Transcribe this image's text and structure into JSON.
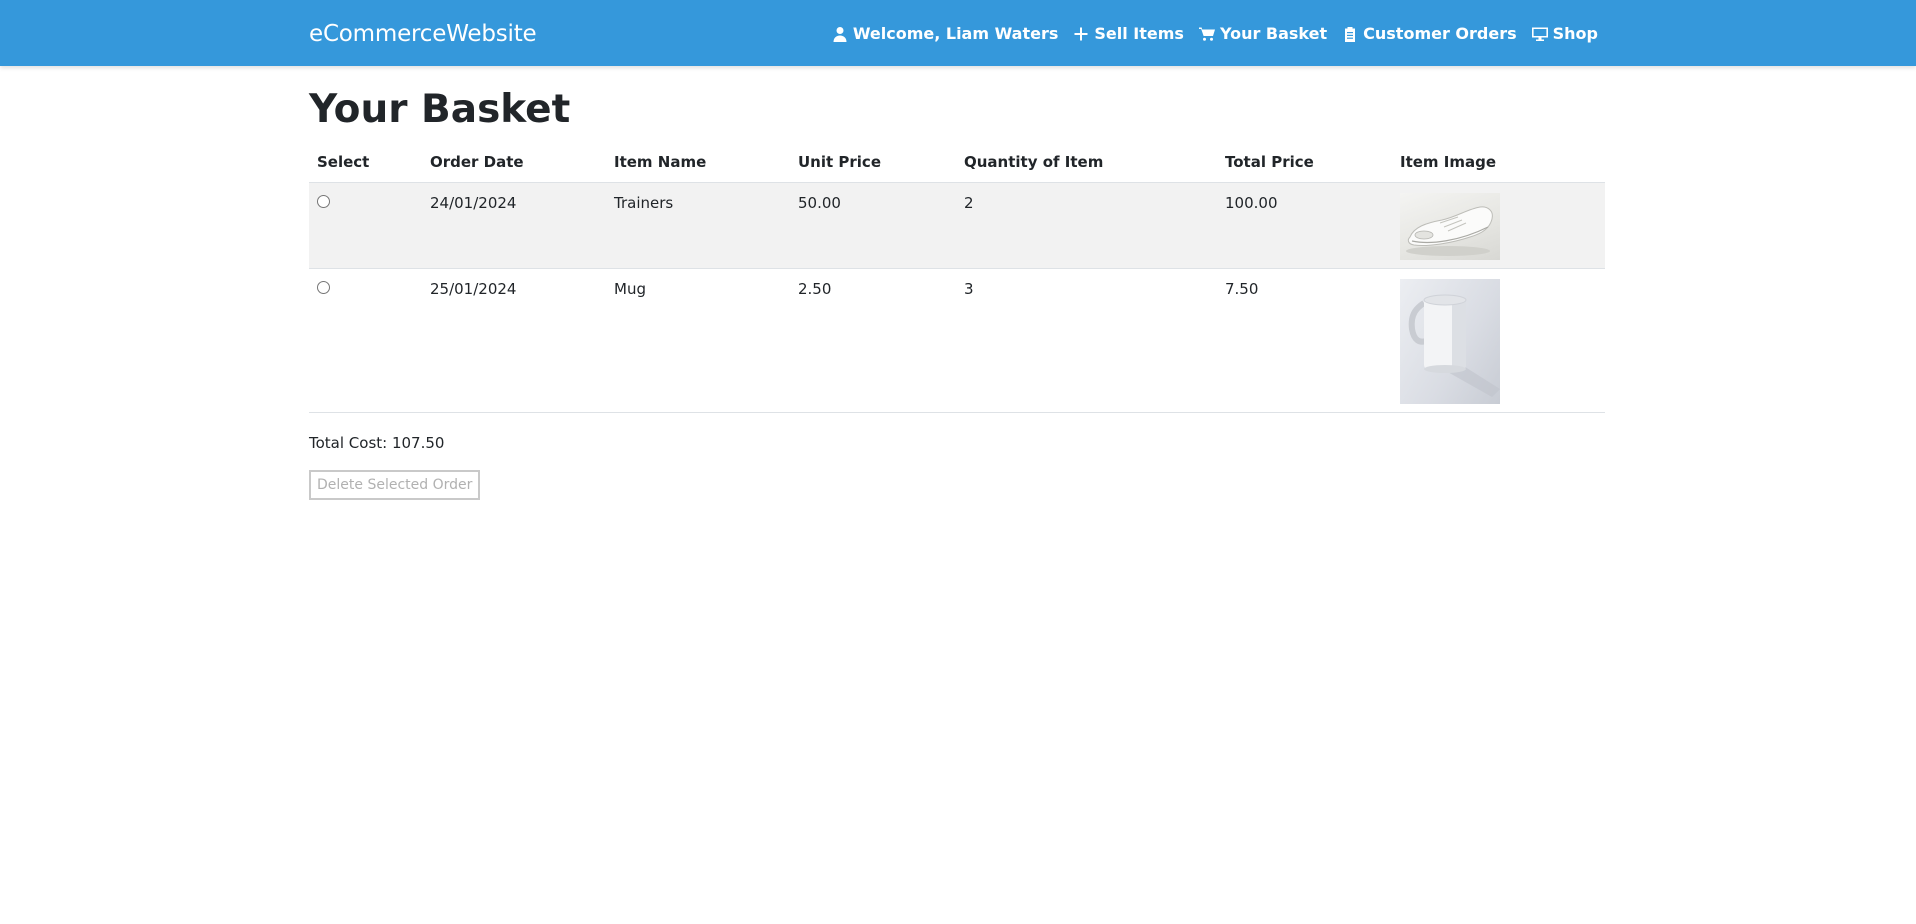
{
  "navbar": {
    "brand": "eCommerceWebsite",
    "background_color": "#3598db",
    "links": [
      {
        "label": "Welcome, Liam Waters",
        "icon": "user-icon"
      },
      {
        "label": "Sell Items",
        "icon": "plus-icon"
      },
      {
        "label": "Your Basket",
        "icon": "cart-icon"
      },
      {
        "label": "Customer Orders",
        "icon": "clipboard-icon"
      },
      {
        "label": "Shop",
        "icon": "monitor-icon"
      }
    ]
  },
  "page": {
    "title": "Your Basket"
  },
  "table": {
    "headers": [
      "Select",
      "Order Date",
      "Item Name",
      "Unit Price",
      "Quantity of Item",
      "Total Price",
      "Item Image"
    ],
    "rows": [
      {
        "order_date": "24/01/2024",
        "item_name": "Trainers",
        "unit_price": "50.00",
        "quantity": "2",
        "total_price": "100.00",
        "image": "trainers-photo",
        "selected": false
      },
      {
        "order_date": "25/01/2024",
        "item_name": "Mug",
        "unit_price": "2.50",
        "quantity": "3",
        "total_price": "7.50",
        "image": "mug-photo",
        "selected": false
      }
    ]
  },
  "summary": {
    "total_cost_label": "Total Cost: 107.50"
  },
  "actions": {
    "delete_label": "Delete Selected Order",
    "delete_disabled": true
  }
}
